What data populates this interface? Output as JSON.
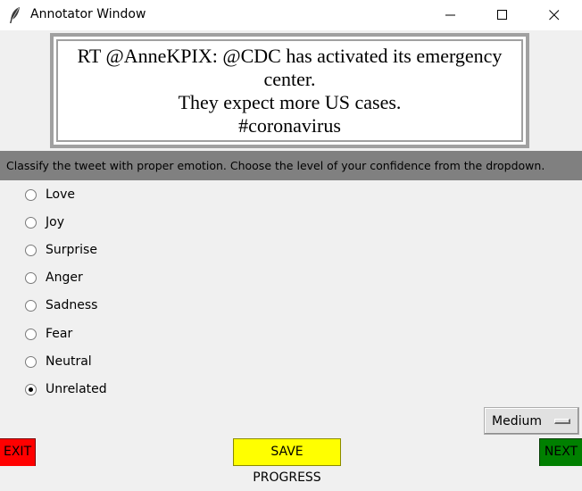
{
  "window": {
    "title": "Annotator Window",
    "icon": "feather-icon"
  },
  "tweet": {
    "text": "RT @AnneKPIX: @CDC has activated its emergency\ncenter.\nThey expect more US cases.\n#coronavirus"
  },
  "instruction": "Classify the tweet with proper emotion. Choose the level of your confidence from the dropdown.",
  "emotions": {
    "options": [
      "Love",
      "Joy",
      "Surprise",
      "Anger",
      "Sadness",
      "Fear",
      "Neutral",
      "Unrelated"
    ],
    "selected": "Unrelated"
  },
  "confidence": {
    "selected": "Medium"
  },
  "buttons": {
    "exit": "EXIT",
    "save": "SAVE PROGRESS",
    "next": "NEXT"
  },
  "colors": {
    "exit": "#ff0000",
    "save": "#ffff00",
    "next": "#008000",
    "instruction_bar": "#808080"
  }
}
